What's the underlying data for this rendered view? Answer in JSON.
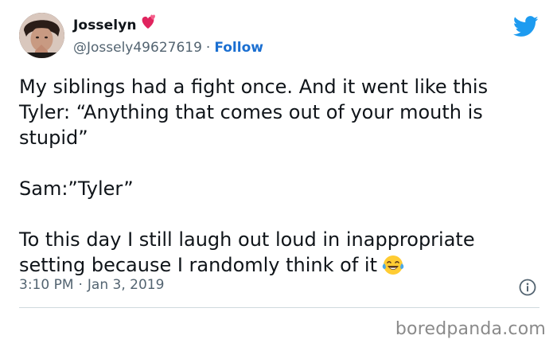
{
  "user": {
    "display_name": "Josselyn",
    "handle": "@Jossely49627619",
    "separator": "·",
    "follow_label": "Follow",
    "name_emoji": "two-hearts-icon"
  },
  "tweet": {
    "lines": [
      "My siblings had a fight once. And it went like this",
      "Tyler: “Anything that comes out of your mouth is",
      "stupid”"
    ],
    "line_sam": "Sam:”Tyler”",
    "last_line_1": "To this day I still laugh out loud in inappropriate",
    "last_line_2": "setting because I randomly think of it",
    "end_emoji": "laughing-tears-icon"
  },
  "meta": {
    "time": "3:10 PM",
    "separator": "·",
    "date": "Jan 3, 2019"
  },
  "watermark": "boredpanda.com",
  "colors": {
    "text": "#0f1419",
    "secondary": "#536471",
    "link": "#1b6fd1",
    "twitter_blue": "#1d9bf0",
    "divider": "#cfd9de",
    "watermark": "#8a8a8a"
  }
}
